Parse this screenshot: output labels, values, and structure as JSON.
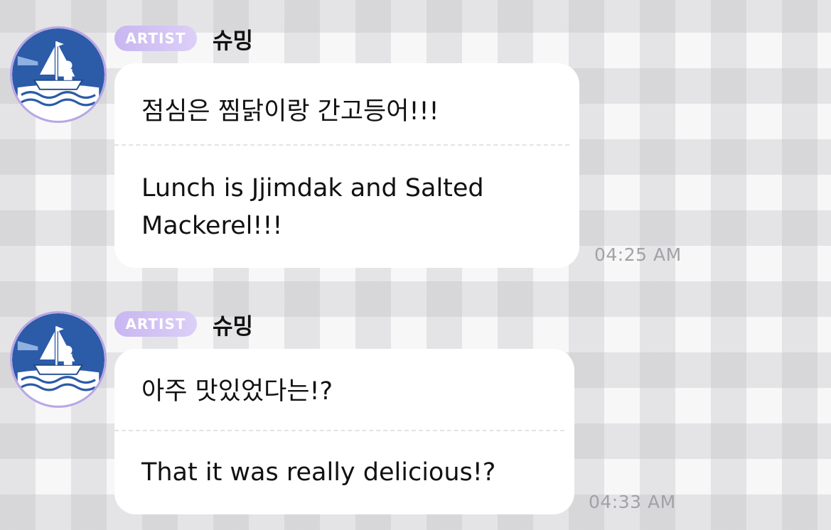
{
  "messages": [
    {
      "badge": "ARTIST",
      "sender": "슈밍",
      "avatar_icon": "ship-sailor-avatar-icon",
      "original_text": "점심은 찜닭이랑 간고등어!!!",
      "translation_line1": "Lunch is Jjimdak and Salted",
      "translation_line2": "Mackerel!!!",
      "time": "04:25 AM"
    },
    {
      "badge": "ARTIST",
      "sender": "슈밍",
      "avatar_icon": "ship-sailor-avatar-icon",
      "original_text": "아주 맛있었다는!?",
      "translation_line1": "That it was really delicious!?",
      "time": "04:33 AM"
    }
  ],
  "colors": {
    "badge_gradient_start": "#c8b6f1",
    "badge_gradient_end": "#dccff7",
    "avatar_ring": "#b9a6e6",
    "avatar_blue": "#2c5ba8",
    "timestamp": "#a2a2a6",
    "bubble": "#ffffff"
  }
}
